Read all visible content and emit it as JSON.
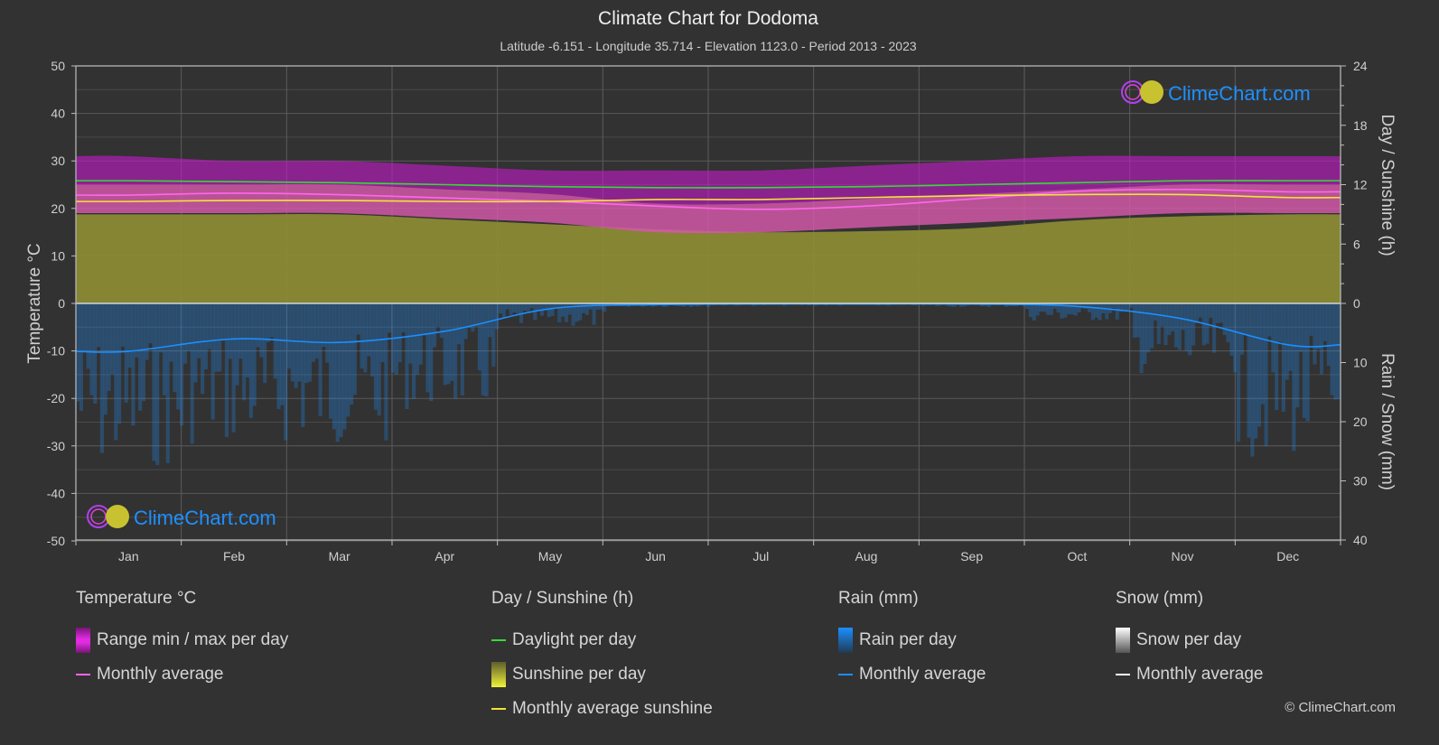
{
  "header": {
    "title": "Climate Chart for Dodoma",
    "subtitle": "Latitude -6.151 - Longitude 35.714 - Elevation 1123.0 - Period 2013 - 2023"
  },
  "brand": {
    "watermark": "ClimeChart.com",
    "copyright": "© ClimeChart.com"
  },
  "colors": {
    "temp_range": "#c21ac8",
    "temp_avg": "#ff66ee",
    "daylight": "#33dd33",
    "sunshine_fill": "#8a8a35",
    "sunshine_avg": "#f2e33a",
    "rain": "#1b8fff",
    "snow": "#ffffff"
  },
  "chart_data": {
    "type": "area",
    "title": "Climate Chart for Dodoma",
    "categories": [
      "Jan",
      "Feb",
      "Mar",
      "Apr",
      "May",
      "Jun",
      "Jul",
      "Aug",
      "Sep",
      "Oct",
      "Nov",
      "Dec"
    ],
    "axes": {
      "left": {
        "label": "Temperature °C",
        "range": [
          -50,
          50
        ],
        "ticks": [
          50,
          40,
          30,
          20,
          10,
          0,
          -10,
          -20,
          -30,
          -40,
          -50
        ]
      },
      "right_top": {
        "label": "Day / Sunshine (h)",
        "range": [
          0,
          24
        ],
        "ticks": [
          24,
          18,
          12,
          6,
          0
        ]
      },
      "right_bottom": {
        "label": "Rain / Snow (mm)",
        "range": [
          0,
          40
        ],
        "ticks": [
          0,
          10,
          20,
          30,
          40
        ]
      }
    },
    "grid": true,
    "series": [
      {
        "name": "Range min / max per day",
        "unit": "°C",
        "kind": "band",
        "max": [
          31,
          30,
          30,
          29,
          28,
          28,
          28,
          29,
          30,
          31,
          31,
          31
        ],
        "min": [
          19,
          19,
          19,
          18,
          17,
          15,
          15,
          16,
          17,
          18,
          19,
          19
        ]
      },
      {
        "name": "Temperature monthly average",
        "unit": "°C",
        "kind": "line",
        "values": [
          22.8,
          23.2,
          22.9,
          22.2,
          21.5,
          20.5,
          19.8,
          20.5,
          22.0,
          23.6,
          24.0,
          23.5
        ]
      },
      {
        "name": "Daylight per day",
        "unit": "h",
        "kind": "line",
        "values": [
          12.4,
          12.3,
          12.2,
          12.0,
          11.8,
          11.7,
          11.7,
          11.8,
          12.0,
          12.2,
          12.4,
          12.4
        ]
      },
      {
        "name": "Sunshine per day",
        "unit": "h",
        "kind": "area",
        "values": [
          9.0,
          9.0,
          9.0,
          8.5,
          8.0,
          7.5,
          7.2,
          7.3,
          7.6,
          8.4,
          8.8,
          9.0
        ]
      },
      {
        "name": "Monthly average sunshine",
        "unit": "h",
        "kind": "line",
        "values": [
          10.3,
          10.4,
          10.4,
          10.3,
          10.3,
          10.5,
          10.5,
          10.7,
          10.9,
          11.0,
          11.0,
          10.7
        ]
      },
      {
        "name": "Rain monthly average",
        "unit": "mm",
        "kind": "line",
        "values": [
          8.1,
          6.0,
          6.6,
          4.7,
          0.9,
          0.2,
          0.1,
          0.1,
          0.1,
          0.5,
          2.6,
          7.0
        ]
      },
      {
        "name": "Rain per day (typical extent)",
        "unit": "mm",
        "kind": "area",
        "values": [
          14,
          12,
          12,
          9,
          2,
          0.3,
          0.2,
          0.2,
          0.3,
          1.5,
          6,
          13
        ]
      },
      {
        "name": "Snow monthly average",
        "unit": "mm",
        "kind": "line",
        "values": [
          0,
          0,
          0,
          0,
          0,
          0,
          0,
          0,
          0,
          0,
          0,
          0
        ]
      }
    ],
    "legend_position": "bottom"
  },
  "legend": {
    "groups": [
      {
        "title": "Temperature °C",
        "items": [
          {
            "label": "Range min / max per day",
            "swatch": "range"
          },
          {
            "label": "Monthly average",
            "swatch": "temp-line"
          }
        ]
      },
      {
        "title": "Day / Sunshine (h)",
        "items": [
          {
            "label": "Daylight per day",
            "swatch": "daylight-line"
          },
          {
            "label": "Sunshine per day",
            "swatch": "sun"
          },
          {
            "label": "Monthly average sunshine",
            "swatch": "sun-line"
          }
        ]
      },
      {
        "title": "Rain (mm)",
        "items": [
          {
            "label": "Rain per day",
            "swatch": "rain"
          },
          {
            "label": "Monthly average",
            "swatch": "rain-line"
          }
        ]
      },
      {
        "title": "Snow (mm)",
        "items": [
          {
            "label": "Snow per day",
            "swatch": "snow"
          },
          {
            "label": "Monthly average",
            "swatch": "snow-line"
          }
        ]
      }
    ]
  }
}
